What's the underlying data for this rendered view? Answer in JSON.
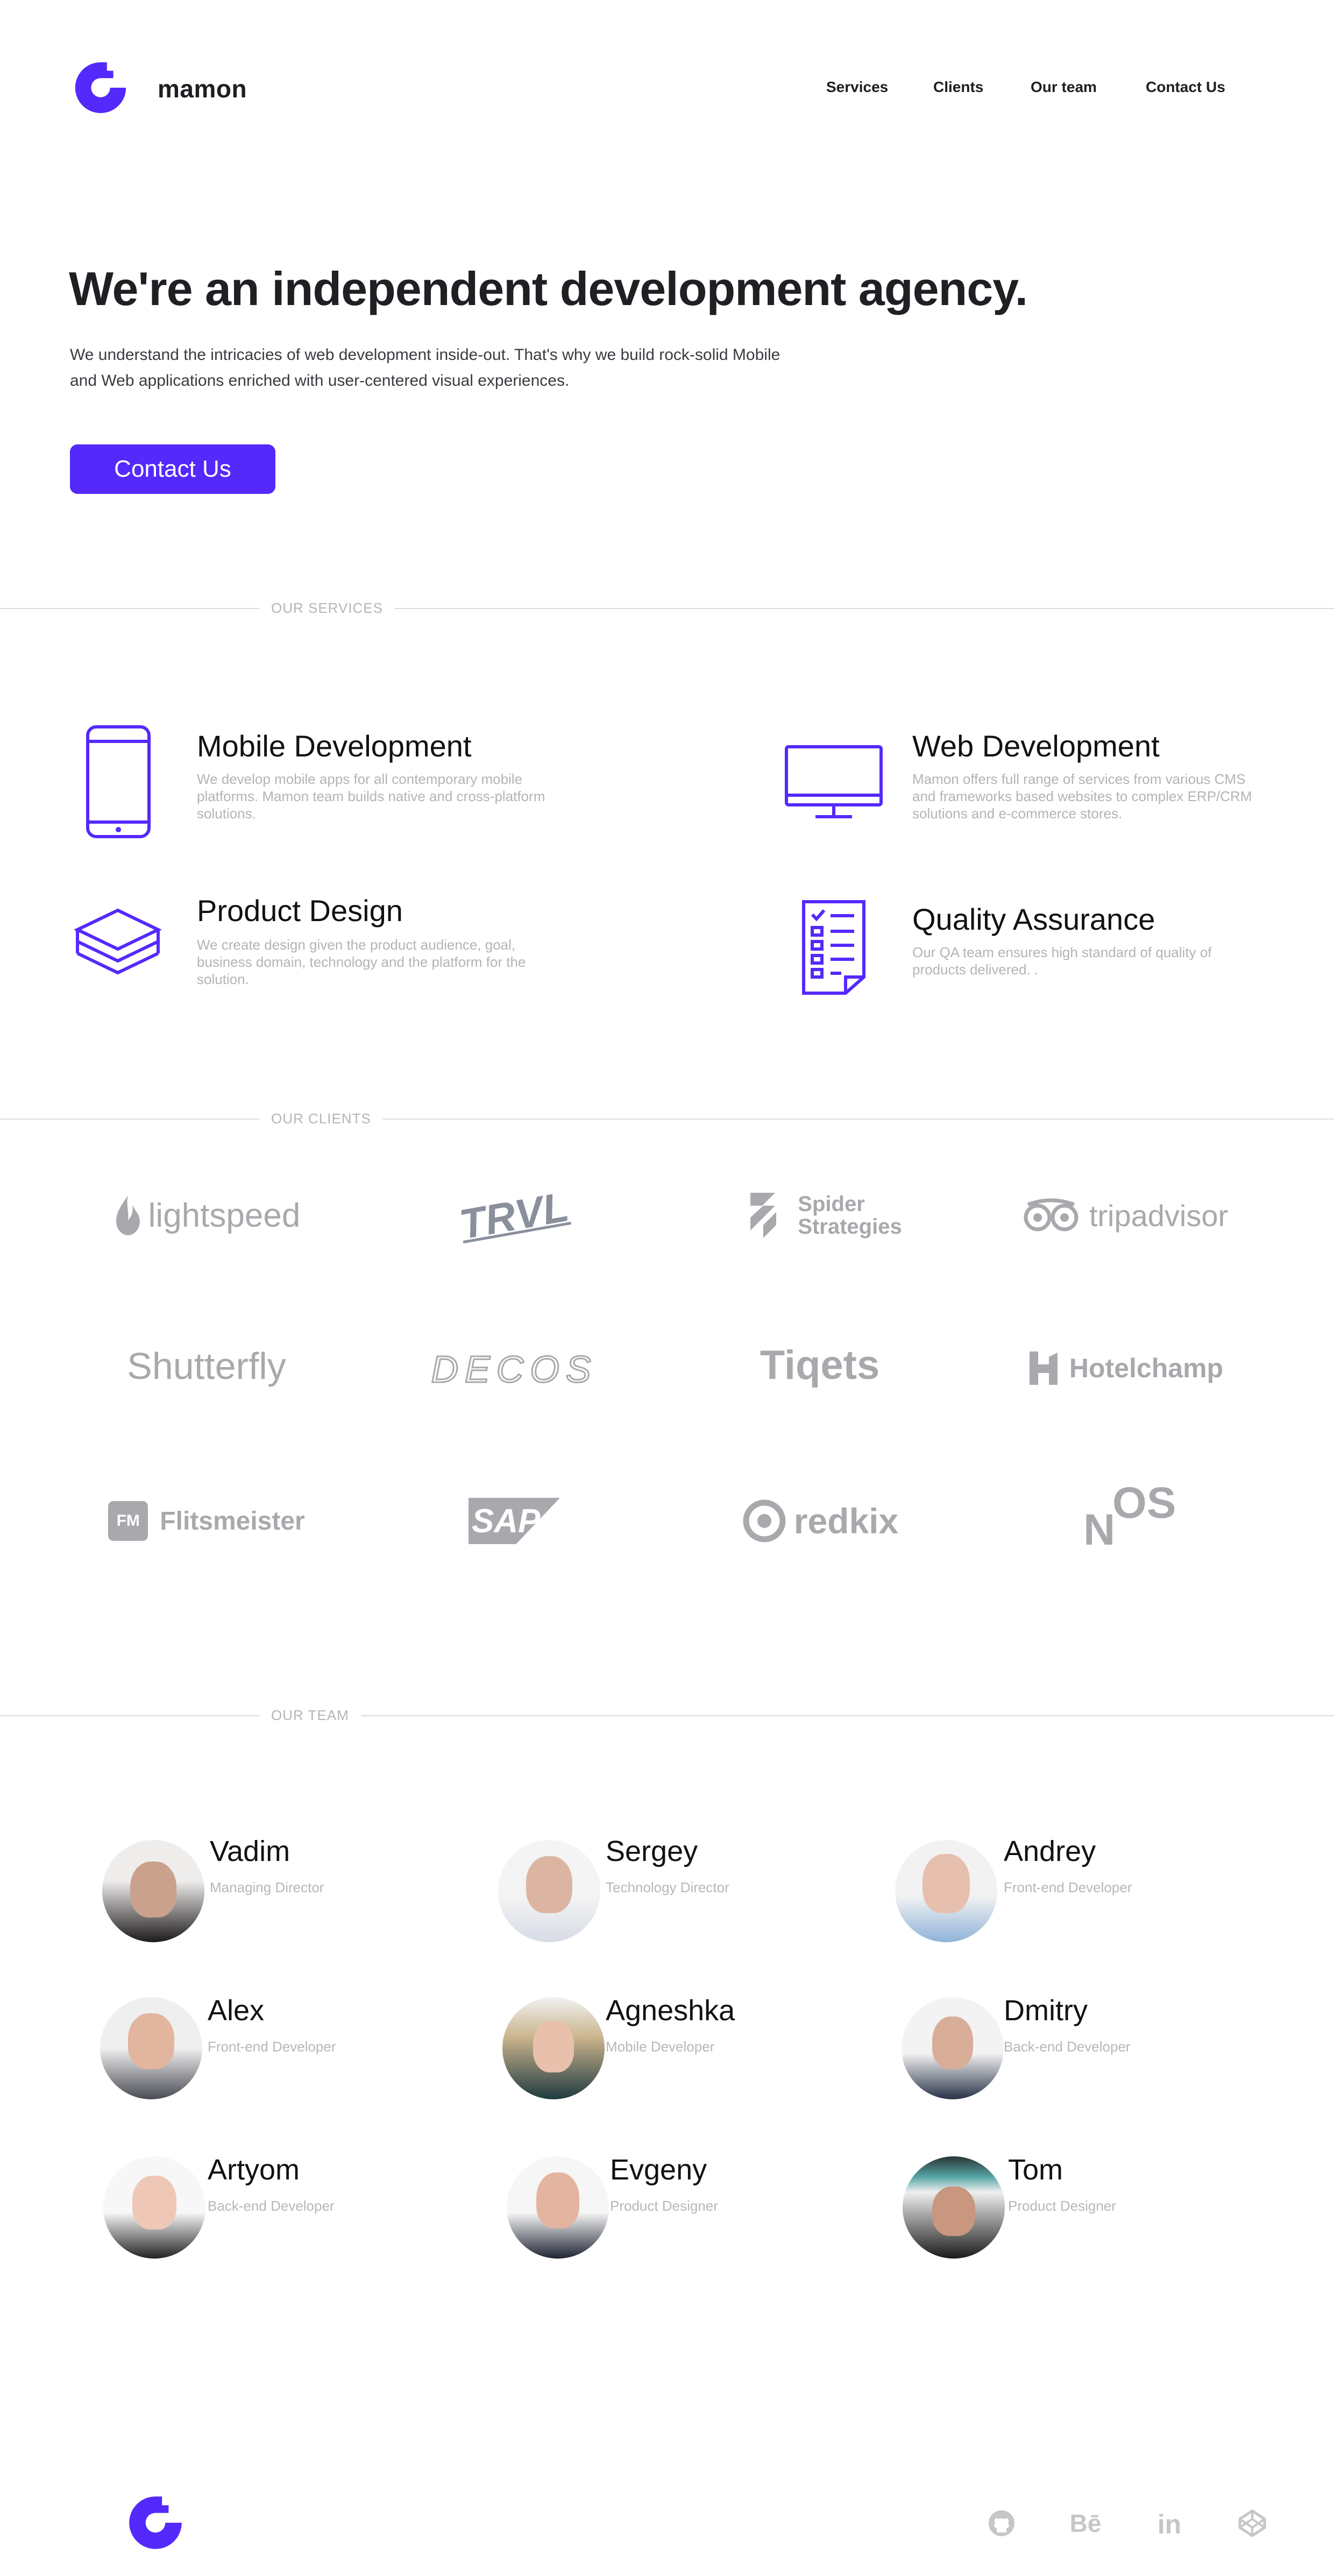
{
  "brand": {
    "name": "mamon",
    "accent": "#5429fb"
  },
  "nav": {
    "services": "Services",
    "clients": "Clients",
    "team": "Our team",
    "contact": "Contact Us"
  },
  "hero": {
    "title": "We're an independent development agency.",
    "line1": "We understand the intricacies of web development inside-out. That's why we build rock-solid Mobile",
    "line2": "and Web applications enriched with user-centered visual experiences.",
    "cta": "Contact Us"
  },
  "sections": {
    "services": "OUR SERVICES",
    "clients": "OUR CLIENTS",
    "team": "OUR TEAM"
  },
  "services": [
    {
      "title": "Mobile Development",
      "desc": "We develop mobile apps for all contemporary mobile platforms. Mamon team builds native and cross-platform solutions.",
      "icon": "smartphone-icon"
    },
    {
      "title": "Web Development",
      "desc": "Mamon offers full range of services from various CMS and frameworks based websites to complex ERP/CRM solutions and e-commerce stores.",
      "icon": "monitor-icon"
    },
    {
      "title": "Product Design",
      "desc": "We create design given the product audience, goal, business domain, technology and the platform for the solution.",
      "icon": "layers-icon"
    },
    {
      "title": "Quality Assurance",
      "desc": "Our QA team ensures high standard of quality of products delivered. .",
      "icon": "checklist-icon"
    }
  ],
  "clients": {
    "lightspeed": "lightspeed",
    "trvl": "TRVL",
    "spider1": "Spider",
    "spider2": "Strategies",
    "tripadvisor": "tripadvisor",
    "shutterfly": "Shutterfly",
    "decos": "DECOS",
    "tiqets": "Tiqets",
    "hotelchamp": "Hotelchamp",
    "fm_badge": "FM",
    "flitsmeister": "Flitsmeister",
    "sap": "SAP",
    "redkix": "redkix",
    "nos_n": "N",
    "nos_os": "OS"
  },
  "team": [
    {
      "name": "Vadim",
      "role": "Managing Director"
    },
    {
      "name": "Sergey",
      "role": "Technology Director"
    },
    {
      "name": "Andrey",
      "role": "Front-end Developer"
    },
    {
      "name": "Alex",
      "role": "Front-end Developer"
    },
    {
      "name": "Agneshka",
      "role": "Mobile Developer"
    },
    {
      "name": "Dmitry",
      "role": "Back-end Developer"
    },
    {
      "name": "Artyom",
      "role": "Back-end Developer"
    },
    {
      "name": "Evgeny",
      "role": "Product Designer"
    },
    {
      "name": "Tom",
      "role": "Product Designer"
    }
  ],
  "footer": {
    "icons": [
      "github-icon",
      "behance-icon",
      "linkedin-icon",
      "codepen-icon"
    ],
    "behance": "Bē",
    "linkedin": "in"
  }
}
